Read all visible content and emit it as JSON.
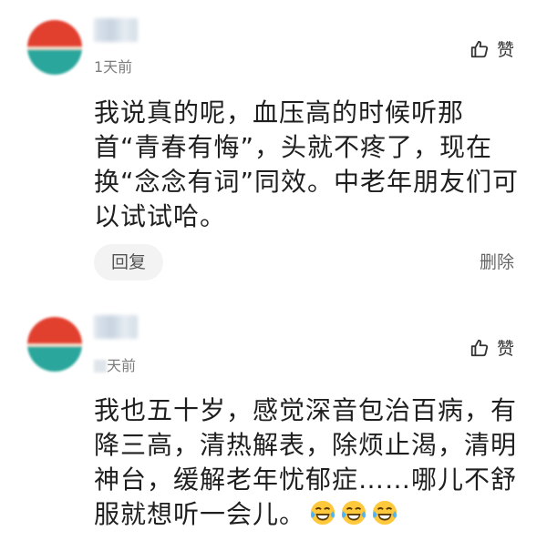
{
  "comments": [
    {
      "time": "1天前",
      "like_label": "赞",
      "text": "我说真的呢，血压高的时候听那首“青春有悔”，头就不疼了，现在换“念念有词”同效。中老年朋友们可以试试哈。",
      "reply_label": "回复",
      "delete_label": "删除",
      "avatar_colors": [
        "#e03b2c",
        "#2aa8a0"
      ]
    },
    {
      "time": "天前",
      "like_label": "赞",
      "text": "我也五十岁，感觉深音包治百病，有降三高，清热解表，除烦止渴，清明神台，缓解老年忧郁症……哪儿不舒服就想听一会儿。",
      "emojis": [
        "laughing-crying-emoji",
        "laughing-crying-emoji",
        "laughing-crying-emoji"
      ],
      "avatar_colors": [
        "#e03b2c",
        "#2aa8a0"
      ]
    }
  ],
  "colors": {
    "text": "#1f1f1f",
    "muted": "#7d7d7d",
    "reply_bg": "#f3f3f3",
    "emoji_yellow": "#ffc83d"
  }
}
